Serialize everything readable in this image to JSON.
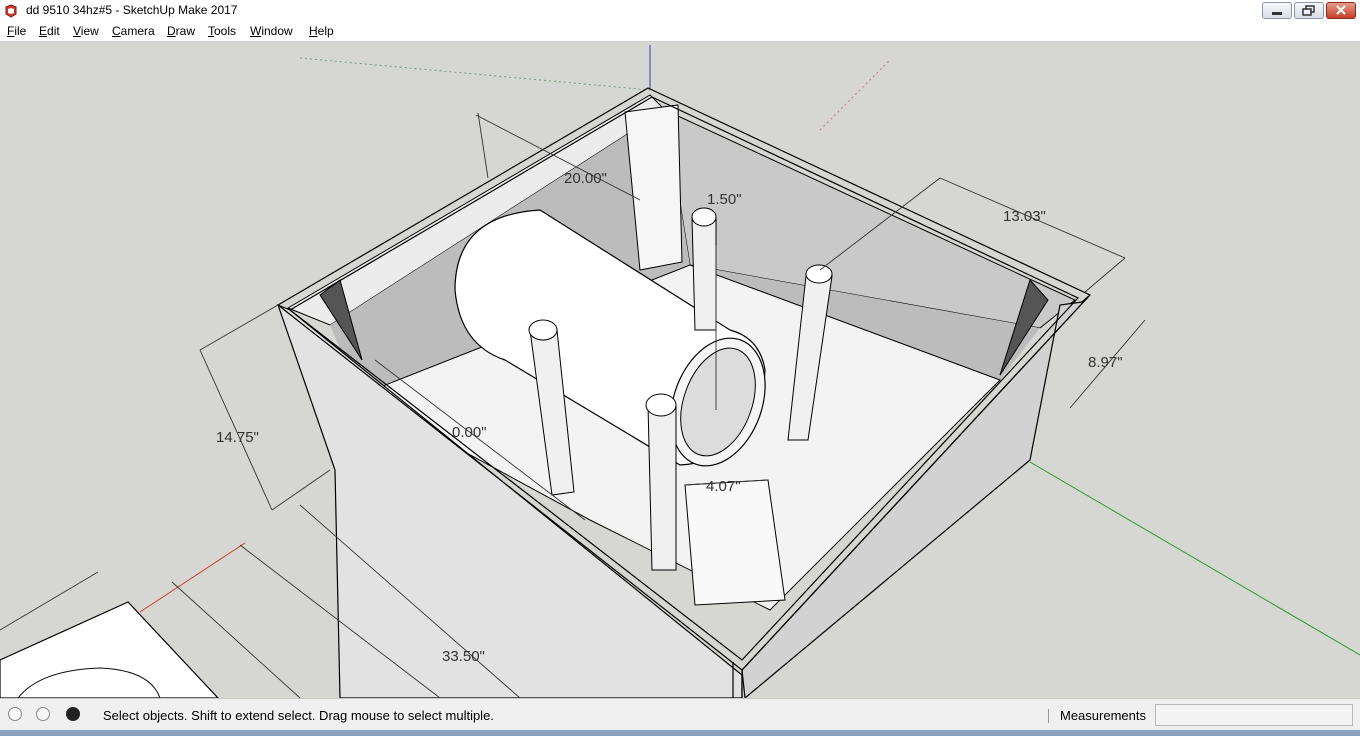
{
  "window": {
    "title": "dd 9510 34hz#5 - SketchUp Make 2017",
    "icon": "sketchup-logo-icon",
    "controls": [
      "minimize-icon",
      "restore-icon",
      "close-icon"
    ]
  },
  "menubar": {
    "items": [
      {
        "label": "File",
        "accel": "F",
        "rest": "ile"
      },
      {
        "label": "Edit",
        "accel": "E",
        "rest": "dit"
      },
      {
        "label": "View",
        "accel": "V",
        "rest": "iew"
      },
      {
        "label": "Camera",
        "accel": "C",
        "rest": "amera"
      },
      {
        "label": "Draw",
        "accel": "D",
        "rest": "raw"
      },
      {
        "label": "Tools",
        "accel": "T",
        "rest": "ools"
      },
      {
        "label": "Window",
        "accel": "W",
        "rest": "indow"
      },
      {
        "label": "Help",
        "accel": "H",
        "rest": "elp"
      }
    ]
  },
  "viewport": {
    "axis_colors": {
      "green": "#2a9a2a",
      "red": "#c83a2a",
      "blue": "#3a3aa0"
    },
    "dimensions": {
      "d_top": "20.00\"",
      "d_right_top": "13.03\"",
      "d_small": "1.50\"",
      "d_right_side": "8.97\"",
      "d_left_height": "14.75\"",
      "d_inner": "0.00\"",
      "d_port": "4.07\"",
      "d_bottom": "33.50\""
    }
  },
  "statusbar": {
    "icons": [
      "geo-location-icon",
      "info-icon",
      "user-icon"
    ],
    "hint": "Select objects. Shift to extend select. Drag mouse to select multiple.",
    "measurements_label": "Measurements",
    "measurements_value": ""
  }
}
